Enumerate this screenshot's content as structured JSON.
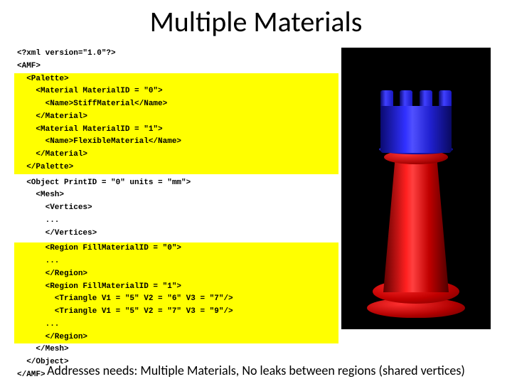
{
  "title": "Multiple Materials",
  "code": {
    "l1": "<?xml version=\"1.0\"?>",
    "l2": "<AMF>",
    "l3": "  <Palette>",
    "l4": "    <Material MaterialID = \"0\">",
    "l5": "      <Name>StiffMaterial</Name>",
    "l6": "    </Material>",
    "l7": "    <Material MaterialID = \"1\">",
    "l8": "      <Name>FlexibleMaterial</Name>",
    "l9": "    </Material>",
    "l10": "  </Palette>",
    "l11": "",
    "l12": "  <Object PrintID = \"0\" units = \"mm\">",
    "l13": "    <Mesh>",
    "l14": "      <Vertices>",
    "l15": "      ...",
    "l16": "      </Vertices>",
    "l17": "",
    "l18": "      <Region FillMaterialID = \"0\">",
    "l19": "      ...",
    "l20": "      </Region>",
    "l21": "      <Region FillMaterialID = \"1\">",
    "l22": "        <Triangle V1 = \"5\" V2 = \"6\" V3 = \"7\"/>",
    "l23": "        <Triangle V1 = \"5\" V2 = \"7\" V3 = \"9\"/>",
    "l24": "      ...",
    "l25": "      </Region>",
    "l26": "    </Mesh>",
    "l27": "  </Object>",
    "l28": "</AMF>"
  },
  "footer": "Addresses needs: Multiple Materials, No leaks between regions (shared vertices)"
}
